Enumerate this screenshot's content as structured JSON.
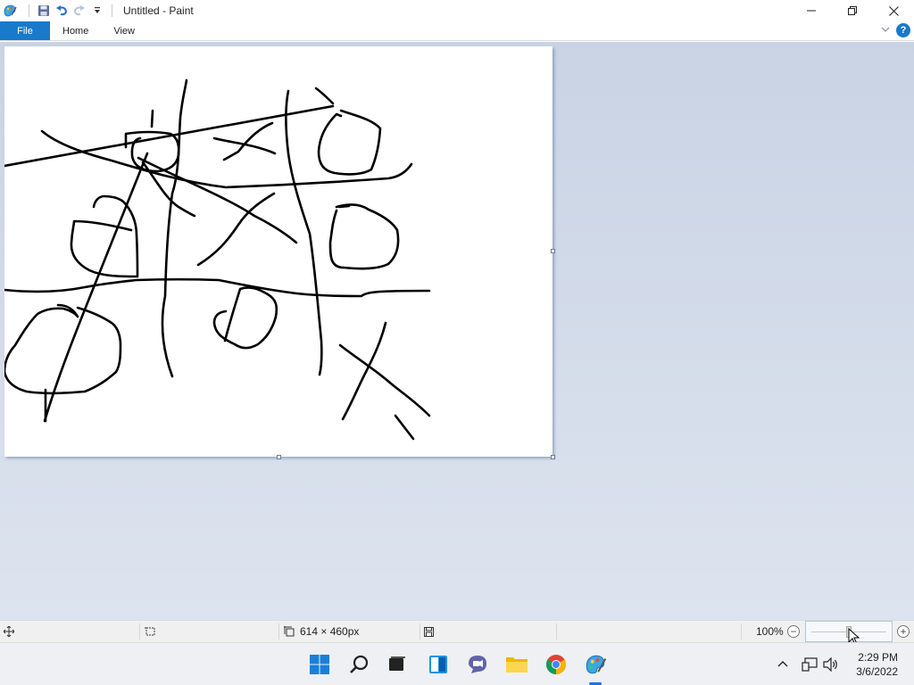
{
  "window": {
    "title": "Untitled - Paint"
  },
  "ribbon": {
    "tabs": [
      {
        "label": "File"
      },
      {
        "label": "Home"
      },
      {
        "label": "View"
      }
    ]
  },
  "canvas": {
    "background": "#ffffff",
    "stroke_color": "#000000"
  },
  "statusbar": {
    "image_size": "614 × 460px",
    "zoom": "100%",
    "zoom_out_symbol": "−",
    "zoom_in_symbol": "+",
    "zoom_level_fraction": 0.5
  },
  "taskbar": {
    "apps": [
      "start-icon",
      "search-icon",
      "task-view-icon",
      "widgets-icon",
      "teams-chat-icon",
      "file-explorer-icon",
      "chrome-icon",
      "paint-icon"
    ],
    "clock_time": "2:29 PM",
    "clock_date": "3/6/2022"
  },
  "colors": {
    "accent": "#1979ca",
    "workspace": "#c9d3e4"
  }
}
